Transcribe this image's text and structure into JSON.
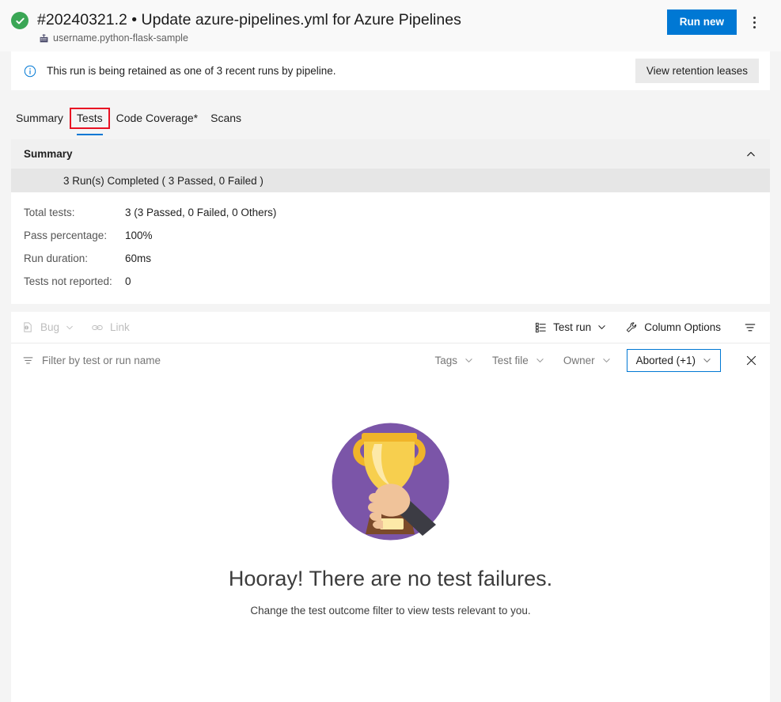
{
  "header": {
    "status_icon": "success-check-icon",
    "run_title": "#20240321.2 • Update azure-pipelines.yml for Azure Pipelines",
    "repo_icon": "repository-icon",
    "repo_name": "username.python-flask-sample",
    "run_new_label": "Run new",
    "more_actions_icon": "more-vertical-icon",
    "accent_color": "#0078d4",
    "success_color": "#3aa655"
  },
  "banner": {
    "icon": "info-icon",
    "message": "This run is being retained as one of 3 recent runs by pipeline.",
    "action_label": "View retention leases"
  },
  "tabs": [
    {
      "label": "Summary",
      "active": false,
      "annotated": false
    },
    {
      "label": "Tests",
      "active": true,
      "annotated": true
    },
    {
      "label": "Code Coverage*",
      "active": false,
      "annotated": false
    },
    {
      "label": "Scans",
      "active": false,
      "annotated": false
    }
  ],
  "annotation": {
    "color": "#e81123",
    "target": "Tests"
  },
  "summary": {
    "title": "Summary",
    "collapse_icon": "chevron-up-icon",
    "runs_completed": "3 Run(s) Completed ( 3 Passed, 0 Failed )",
    "stats": [
      {
        "label": "Total tests:",
        "value": "3 (3 Passed, 0 Failed, 0 Others)"
      },
      {
        "label": "Pass percentage:",
        "value": "100%"
      },
      {
        "label": "Run duration:",
        "value": "60ms"
      },
      {
        "label": "Tests not reported:",
        "value": "0"
      }
    ]
  },
  "toolbar": {
    "bug_label": "Bug",
    "bug_icon": "bug-icon",
    "link_label": "Link",
    "link_icon": "link-icon",
    "test_run_label": "Test run",
    "test_run_icon": "group-list-icon",
    "column_options_label": "Column Options",
    "column_options_icon": "wrench-icon",
    "filter_toggle_icon": "filter-icon"
  },
  "filter_bar": {
    "filter_icon": "filter-icon",
    "placeholder": "Filter by test or run name",
    "value": "",
    "dropdowns": [
      {
        "label": "Tags",
        "active": false
      },
      {
        "label": "Test file",
        "active": false
      },
      {
        "label": "Owner",
        "active": false
      },
      {
        "label": "Aborted (+1)",
        "active": true
      }
    ],
    "close_icon": "close-icon"
  },
  "empty_state": {
    "illustration": "trophy-in-hand-illustration",
    "title": "Hooray! There are no test failures.",
    "subtitle": "Change the test outcome filter to view tests relevant to you.",
    "circle_color": "#7b55a8",
    "trophy_color": "#f2c13c"
  }
}
